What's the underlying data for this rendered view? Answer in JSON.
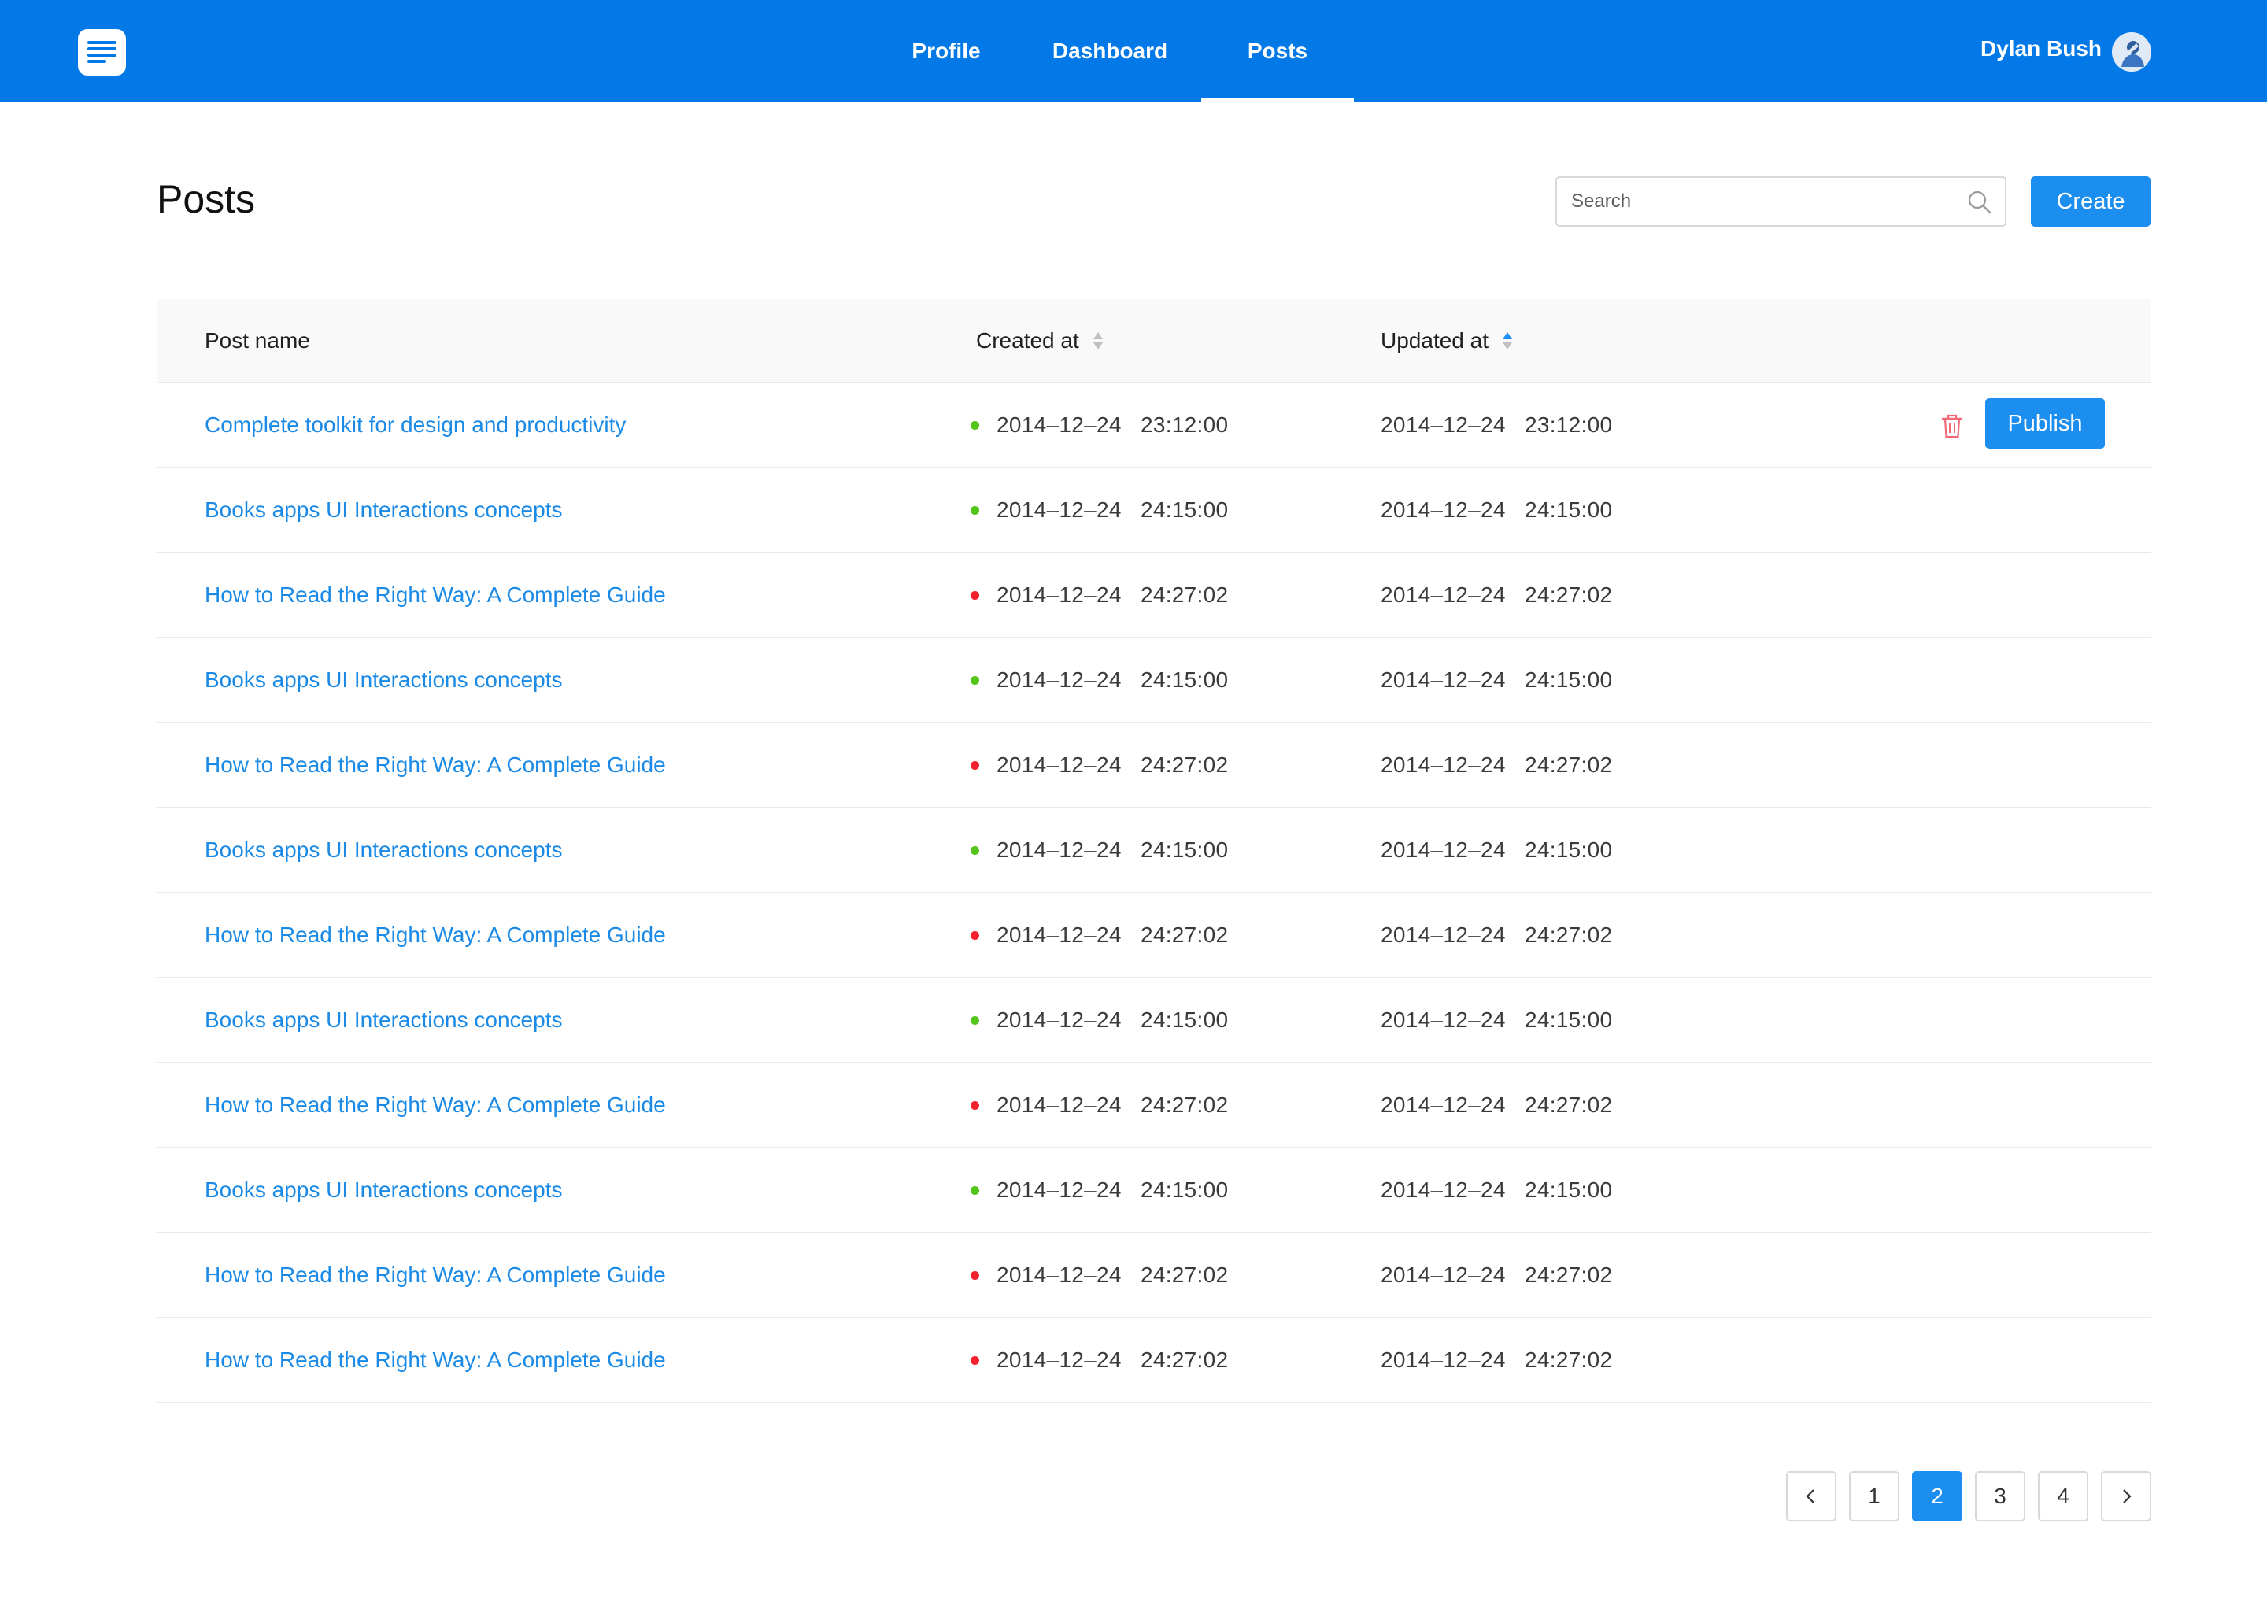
{
  "header": {
    "nav": [
      {
        "label": "Profile"
      },
      {
        "label": "Dashboard"
      },
      {
        "label": "Posts"
      }
    ],
    "active_nav": "Posts",
    "user_name": "Dylan Bush",
    "avatar_icon": "user-avatar"
  },
  "page": {
    "title": "Posts",
    "search_placeholder": "Search",
    "create_label": "Create"
  },
  "table": {
    "columns": [
      {
        "label": "Post name"
      },
      {
        "label": "Created at",
        "sort": "none"
      },
      {
        "label": "Updated at",
        "sort": "ascending"
      }
    ],
    "rows": [
      {
        "name": "Complete toolkit for design and productivity",
        "created": "2014–12–24   23:12:00",
        "updated": "2014–12–24   23:12:00",
        "status": "green",
        "publish_label": "Publish"
      },
      {
        "name": "Books apps UI Interactions concepts",
        "created": "2014–12–24   24:15:00",
        "updated": "2014–12–24   24:15:00",
        "status": "green"
      },
      {
        "name": "How to Read the Right Way: A Complete Guide",
        "created": "2014–12–24   24:27:02",
        "updated": "2014–12–24   24:27:02",
        "status": "red"
      },
      {
        "name": "Books apps UI Interactions concepts",
        "created": "2014–12–24   24:15:00",
        "updated": "2014–12–24   24:15:00",
        "status": "green"
      },
      {
        "name": "How to Read the Right Way: A Complete Guide",
        "created": "2014–12–24   24:27:02",
        "updated": "2014–12–24   24:27:02",
        "status": "red"
      },
      {
        "name": "Books apps UI Interactions concepts",
        "created": "2014–12–24   24:15:00",
        "updated": "2014–12–24   24:15:00",
        "status": "green"
      },
      {
        "name": "How to Read the Right Way: A Complete Guide",
        "created": "2014–12–24   24:27:02",
        "updated": "2014–12–24   24:27:02",
        "status": "red"
      },
      {
        "name": "Books apps UI Interactions concepts",
        "created": "2014–12–24   24:15:00",
        "updated": "2014–12–24   24:15:00",
        "status": "green"
      },
      {
        "name": "How to Read the Right Way: A Complete Guide",
        "created": "2014–12–24   24:27:02",
        "updated": "2014–12–24   24:27:02",
        "status": "red"
      },
      {
        "name": "Books apps UI Interactions concepts",
        "created": "2014–12–24   24:15:00",
        "updated": "2014–12–24   24:15:00",
        "status": "green"
      },
      {
        "name": "How to Read the Right Way: A Complete Guide",
        "created": "2014–12–24   24:27:02",
        "updated": "2014–12–24   24:27:02",
        "status": "red"
      },
      {
        "name": "How to Read the Right Way: A Complete Guide",
        "created": "2014–12–24   24:27:02",
        "updated": "2014–12–24   24:27:02",
        "status": "red"
      }
    ]
  },
  "pagination": {
    "pages": [
      "1",
      "2",
      "3",
      "4"
    ],
    "current": "2",
    "prev_icon": "chevron-left-icon",
    "next_icon": "chevron-right-icon"
  },
  "colors": {
    "brand": "#0279e6",
    "primary_button": "#1b8ef0",
    "link": "#1a8ae6",
    "status_green": "#52c41a",
    "status_red": "#f5222d",
    "delete_icon": "#f06a7a"
  }
}
